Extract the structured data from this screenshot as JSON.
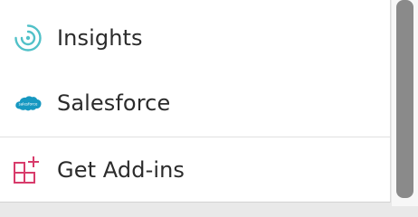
{
  "menu": {
    "items": [
      {
        "label": "Insights",
        "icon": "insights-icon",
        "color": "#51c1c8"
      },
      {
        "label": "Salesforce",
        "icon": "salesforce-cloud-icon",
        "color": "#1798c1",
        "icon_text": "salesforce"
      },
      {
        "label": "Get Add-ins",
        "icon": "get-add-ins-icon",
        "color": "#d83b6b"
      }
    ]
  },
  "scrollbar": {
    "thumb_color": "#8a8a8a"
  }
}
